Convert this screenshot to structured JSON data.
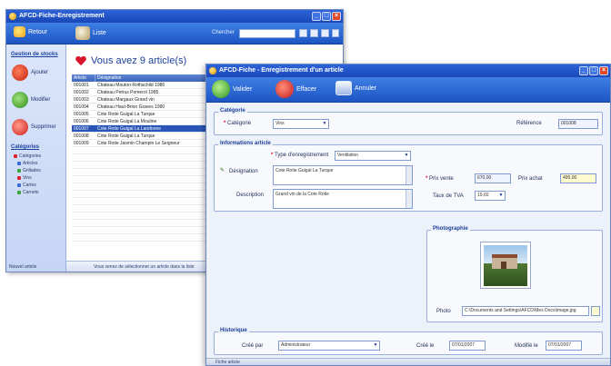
{
  "back_window": {
    "title": "AFCD-Fiche-Enregistrement",
    "toolbar": {
      "btn1": "Retour",
      "btn2": "Liste",
      "search_label": "Chercher"
    },
    "sidebar": {
      "head1": "Gestion de stocks",
      "btn_a": "Ajouter",
      "btn_b": "Modifier",
      "btn_c": "Supprimer",
      "head2": "Catégories",
      "tree": [
        "Catégories",
        "Articles",
        "Grillades",
        "Vins",
        "Cartes",
        "Carnets"
      ],
      "footer": "Nouvel article"
    },
    "heading": "Vous avez 9 article(s)",
    "table": {
      "columns": [
        "Article",
        "Désignation"
      ],
      "rows": [
        [
          "001001",
          "Chateau Mouton Rothschild 1986"
        ],
        [
          "001002",
          "Chateau Petrus Pomerol 1985"
        ],
        [
          "001003",
          "Chateau Margaux Grand vin"
        ],
        [
          "001004",
          "Chateau Haut-Brion Graves 1990"
        ],
        [
          "001005",
          "Cote Rotie Guigal La Turque"
        ],
        [
          "001006",
          "Cote Rotie Guigal La Mouline"
        ],
        [
          "001007",
          "Cote Rotie Guigal La Landonne"
        ],
        [
          "001008",
          "Cote Rotie Guigal La Turque"
        ],
        [
          "001009",
          "Cote Rotie Jasmin Champin Le Seigneur"
        ]
      ],
      "selected_row": 6
    },
    "status": "Vous venez de sélectionner un article dans la liste"
  },
  "front_window": {
    "title": "AFCD-Fiche - Enregistrement d'un article",
    "toolbar": {
      "save": "Valider",
      "delete": "Effacer",
      "cancel": "Annuler"
    },
    "cat_group": {
      "title": "Catégorie",
      "label": "Catégorie",
      "value": "Vins",
      "ref_label": "Référence",
      "ref_value": "001008"
    },
    "art_group": {
      "title": "Informations article",
      "type_label": "Type d'enregistrement",
      "type_value": "Ventilation",
      "designation_label": "Désignation",
      "designation_value": "Cote Rotie Guigal La Turque",
      "description_label": "Description",
      "description_value": "Grand vin de la Cote Rotie",
      "price_label": "Prix vente",
      "price_value": "670,00",
      "price2_label": "Prix achat",
      "price2_value": "495,00",
      "vat_label": "Taux de TVA",
      "vat_value": "19,60"
    },
    "photo_group": {
      "title": "Photographie",
      "path_label": "Photo",
      "path_value": "C:\\Documents and Settings\\AFCD\\Mes Docs\\image.jpg"
    },
    "history": {
      "title": "Historique",
      "owner_label": "Créé par",
      "owner_value": "Administrateur",
      "created_label": "Créé le",
      "created_value": "07/01/2007",
      "modified_label": "Modifié le",
      "modified_value": "07/01/2007"
    },
    "footer": "Fiche article"
  },
  "colors": {
    "titlebar": "#1a47b6",
    "toolbar": "#2a66d6",
    "required": "#d3122a",
    "selected_row": "#2a55b8"
  }
}
